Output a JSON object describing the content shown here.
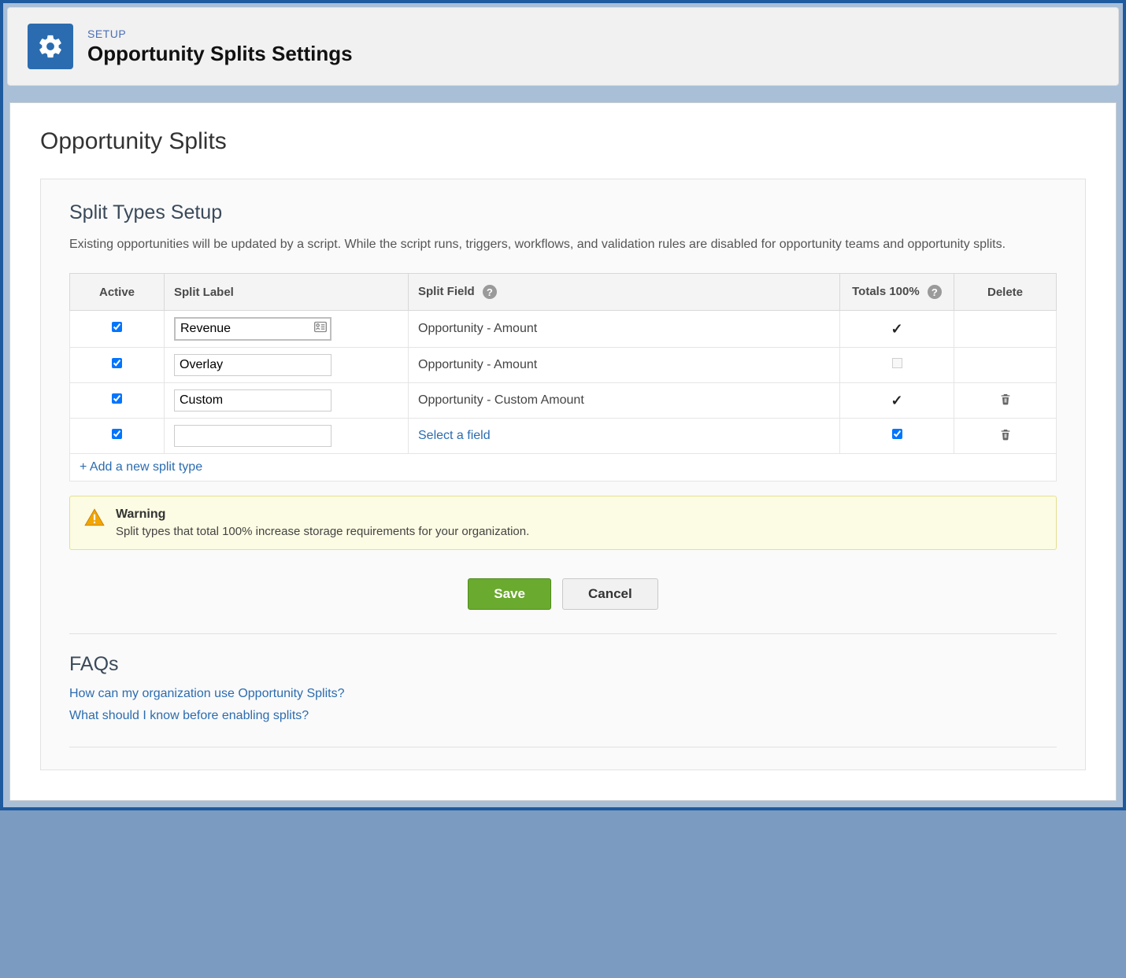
{
  "header": {
    "breadcrumb": "SETUP",
    "title": "Opportunity Splits Settings"
  },
  "page": {
    "title": "Opportunity Splits"
  },
  "section": {
    "title": "Split Types Setup",
    "description": "Existing opportunities will be updated by a script. While the script runs, triggers, workflows, and validation rules are disabled for opportunity teams and opportunity splits."
  },
  "table": {
    "headers": {
      "active": "Active",
      "split_label": "Split Label",
      "split_field": "Split Field",
      "totals": "Totals 100%",
      "delete": "Delete"
    },
    "rows": [
      {
        "active": true,
        "label": "Revenue",
        "label_lookup": true,
        "field_text": "Opportunity - Amount",
        "field_is_link": false,
        "totals_state": "checked-static",
        "deletable": false
      },
      {
        "active": true,
        "label": "Overlay",
        "label_lookup": false,
        "field_text": "Opportunity - Amount",
        "field_is_link": false,
        "totals_state": "unchecked-static",
        "deletable": false
      },
      {
        "active": true,
        "label": "Custom",
        "label_lookup": false,
        "field_text": "Opportunity - Custom Amount",
        "field_is_link": false,
        "totals_state": "checked-static",
        "deletable": true
      },
      {
        "active": true,
        "label": "",
        "label_lookup": false,
        "field_text": "Select a field",
        "field_is_link": true,
        "totals_state": "checkbox-checked",
        "deletable": true
      }
    ],
    "add_link": "+ Add a new split type"
  },
  "warning": {
    "title": "Warning",
    "text": "Split types that total 100% increase storage requirements for your organization."
  },
  "buttons": {
    "save": "Save",
    "cancel": "Cancel"
  },
  "faqs": {
    "title": "FAQs",
    "links": [
      "How can my organization use Opportunity Splits?",
      "What should I know before enabling splits?"
    ]
  }
}
